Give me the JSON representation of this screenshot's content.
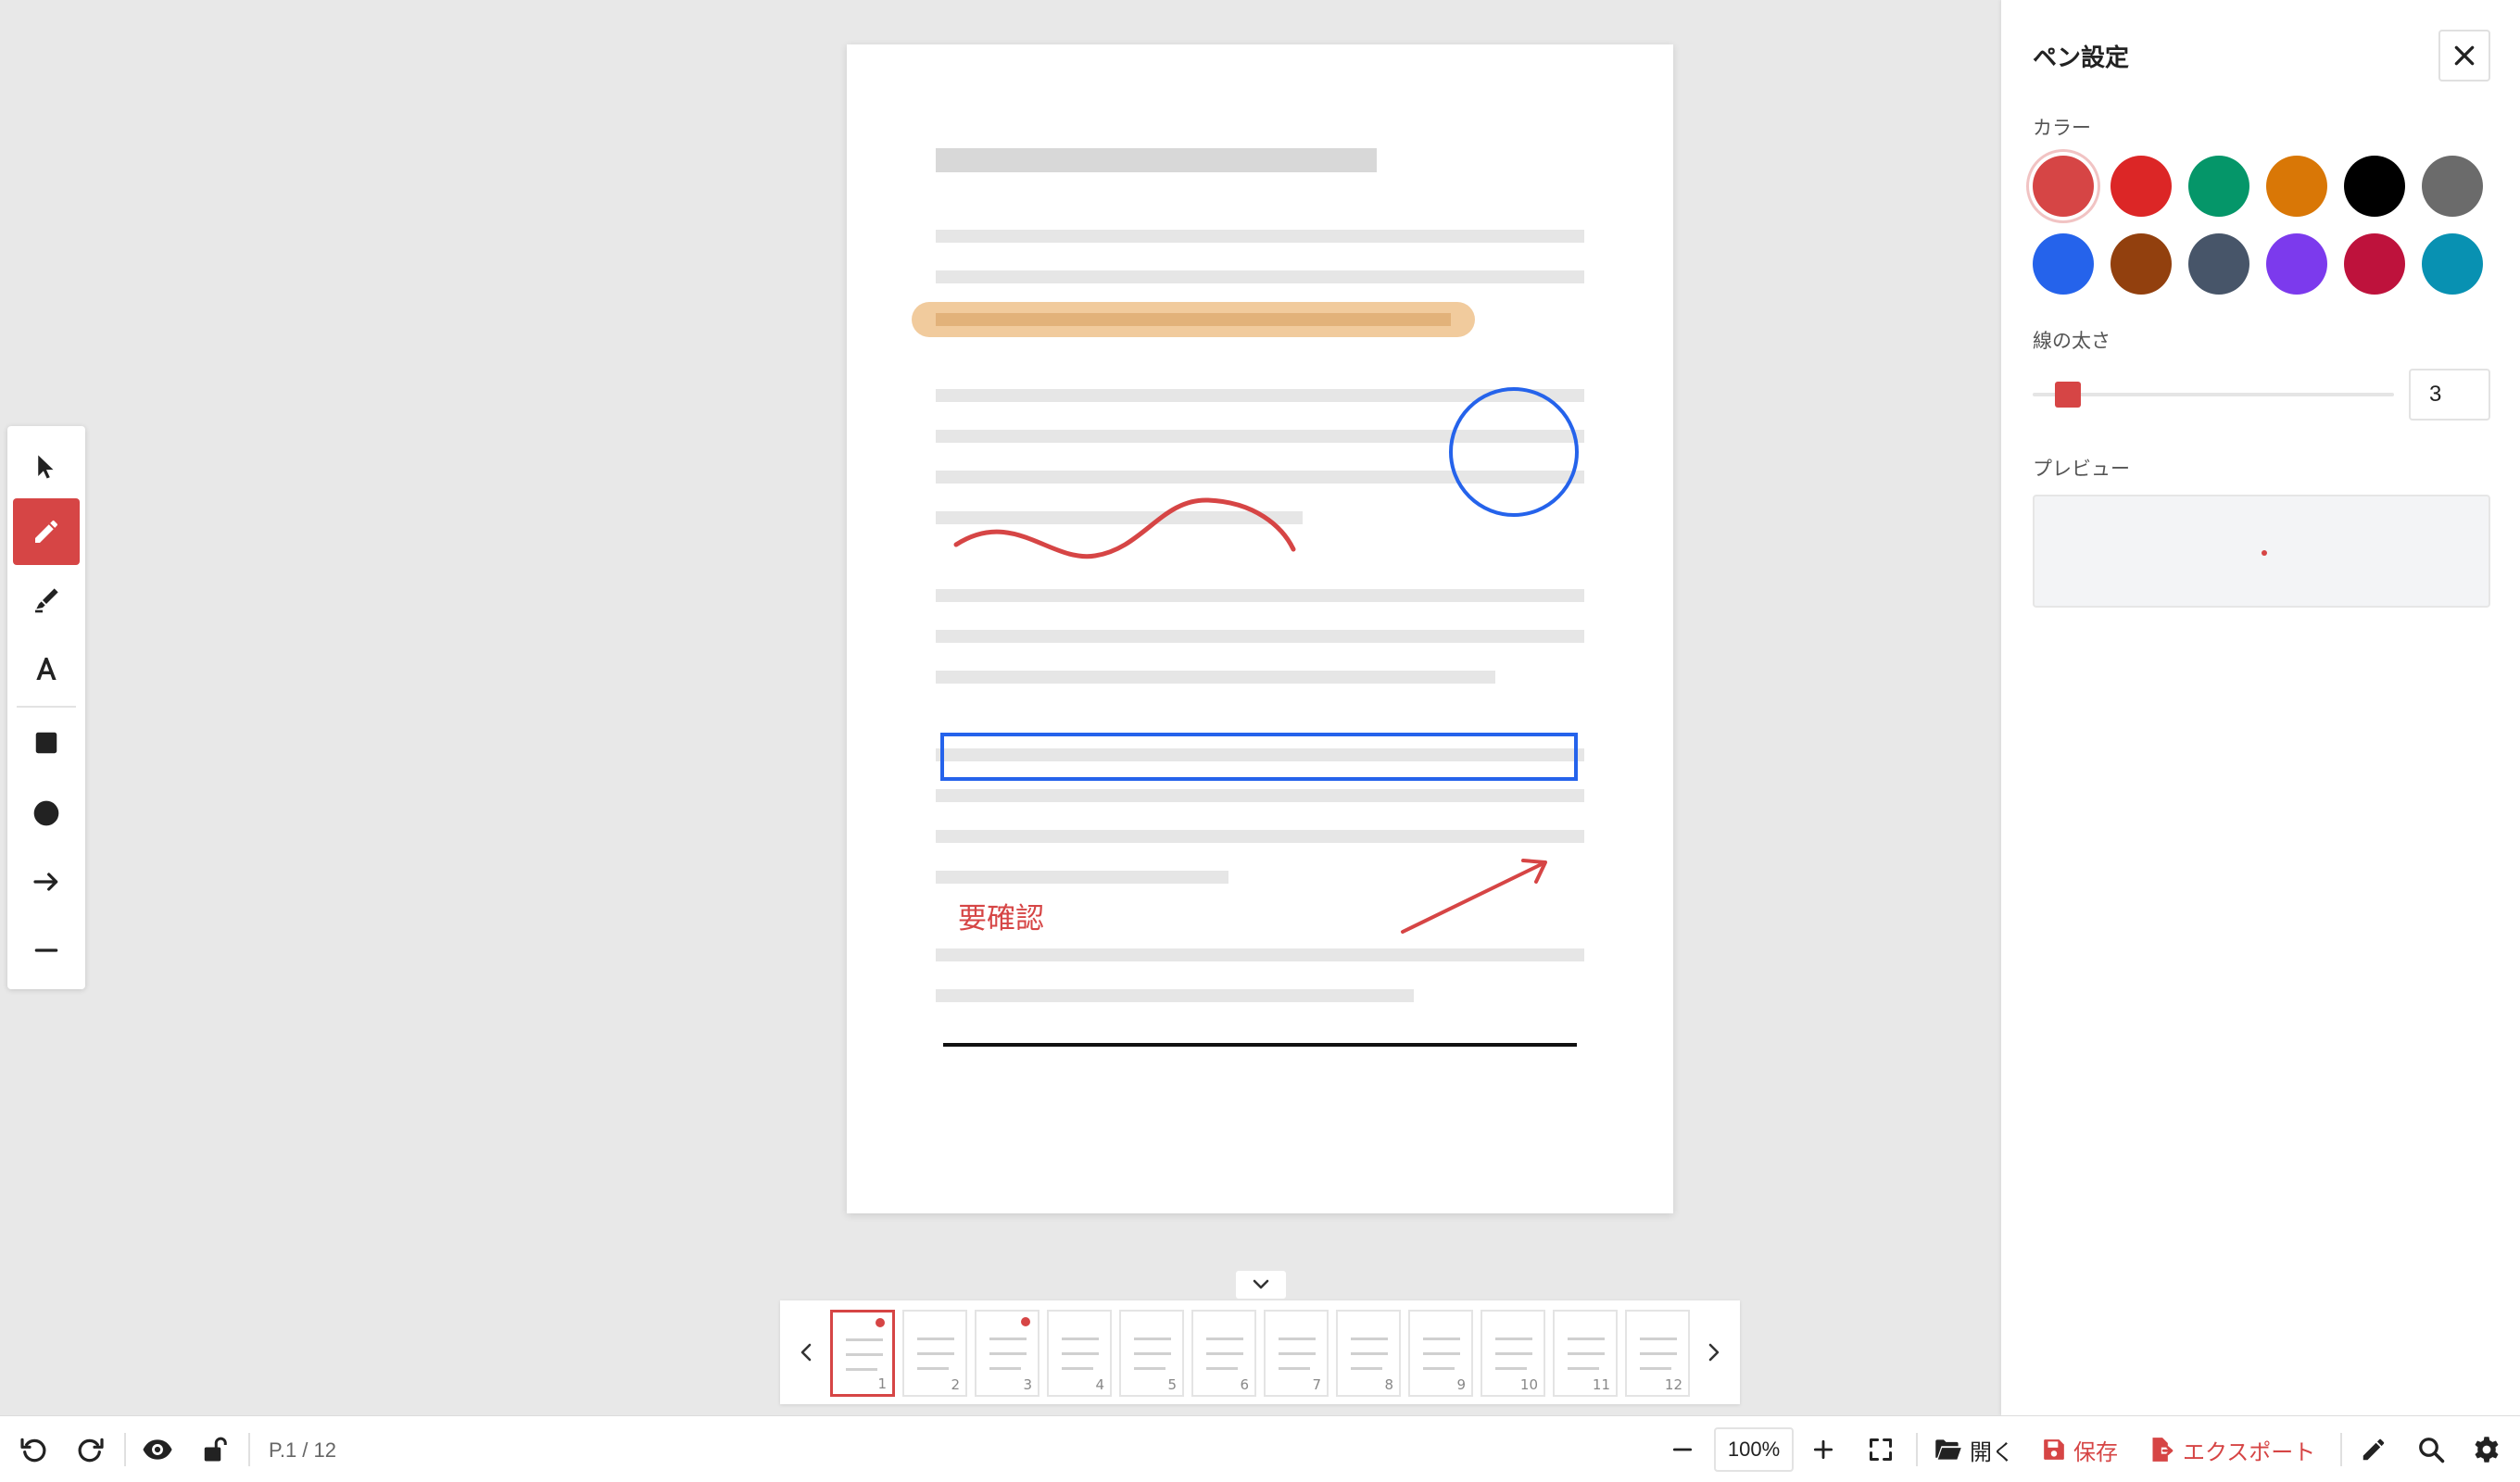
{
  "panel": {
    "title": "ペン設定",
    "color_label": "カラー",
    "width_label": "線の太さ",
    "width_value": "3",
    "width_min": 1,
    "width_max": 50,
    "preview_label": "プレビュー",
    "colors": [
      "#d64545",
      "#dc2626",
      "#059669",
      "#d97706",
      "#000000",
      "#6b6b6b",
      "#2563eb",
      "#92400e",
      "#475569",
      "#7c3aed",
      "#be123c",
      "#0891b2"
    ],
    "selected_color": "#d64545"
  },
  "annotation": {
    "text": "要確認",
    "color": "#d64545"
  },
  "statusbar": {
    "page_indicator": "P.1 / 12",
    "zoom": "100%",
    "open_label": "開く",
    "save_label": "保存",
    "export_label": "エクスポート"
  },
  "thumbnails": {
    "pages": [
      "1",
      "2",
      "3",
      "4",
      "5",
      "6",
      "7",
      "8",
      "9",
      "10",
      "11",
      "12"
    ],
    "selected": "1",
    "annotated_pages": [
      "1",
      "3"
    ]
  },
  "toolbar": {
    "tools": [
      "select-icon",
      "pen-icon",
      "highlighter-icon",
      "text-icon",
      "rectangle-icon",
      "ellipse-icon",
      "arrow-icon",
      "line-icon"
    ],
    "active": "pen-icon"
  },
  "accent_color": "#d64545"
}
